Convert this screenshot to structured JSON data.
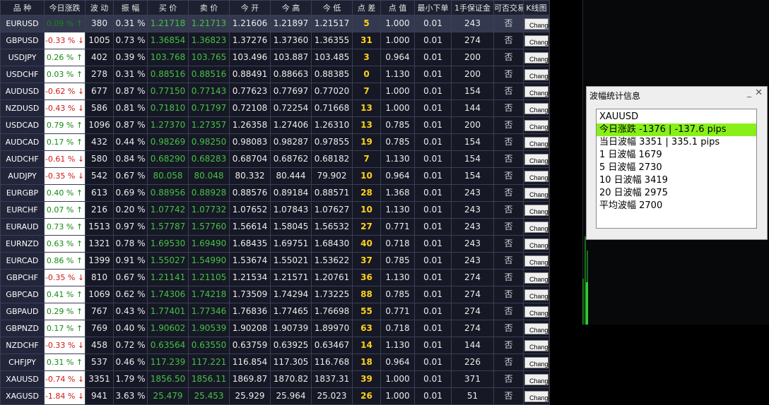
{
  "headers": [
    "品 种",
    "今日涨跌",
    "波 动",
    "振 幅",
    "买 价",
    "卖 价",
    "今 开",
    "今 高",
    "今 低",
    "点 差",
    "点 值",
    "最小下单",
    "1手保证金",
    "可否交易",
    "K线图"
  ],
  "rows": [
    {
      "sym": "EURUSD",
      "chg": "0.09 % ↑",
      "dir": "up",
      "vol": "380",
      "amp": "0.31 %",
      "bid": "1.21718",
      "ask": "1.21713",
      "open": "1.21606",
      "high": "1.21897",
      "low": "1.21517",
      "spread": "5",
      "pv": "1.000",
      "min": "0.01",
      "margin": "243",
      "trade": "否",
      "kline": "Change"
    },
    {
      "sym": "GBPUSD",
      "chg": "-0.33 % ↓",
      "dir": "down",
      "vol": "1005",
      "amp": "0.73 %",
      "bid": "1.36854",
      "ask": "1.36823",
      "open": "1.37276",
      "high": "1.37360",
      "low": "1.36355",
      "spread": "31",
      "pv": "1.000",
      "min": "0.01",
      "margin": "274",
      "trade": "否",
      "kline": "Change"
    },
    {
      "sym": "USDJPY",
      "chg": "0.26 % ↑",
      "dir": "up",
      "vol": "402",
      "amp": "0.39 %",
      "bid": "103.768",
      "ask": "103.765",
      "open": "103.496",
      "high": "103.887",
      "low": "103.485",
      "spread": "3",
      "pv": "0.964",
      "min": "0.01",
      "margin": "200",
      "trade": "否",
      "kline": "Change"
    },
    {
      "sym": "USDCHF",
      "chg": "0.03 % ↑",
      "dir": "up",
      "vol": "278",
      "amp": "0.31 %",
      "bid": "0.88516",
      "ask": "0.88516",
      "open": "0.88491",
      "high": "0.88663",
      "low": "0.88385",
      "spread": "0",
      "pv": "1.130",
      "min": "0.01",
      "margin": "200",
      "trade": "否",
      "kline": "Change"
    },
    {
      "sym": "AUDUSD",
      "chg": "-0.62 % ↓",
      "dir": "down",
      "vol": "677",
      "amp": "0.87 %",
      "bid": "0.77150",
      "ask": "0.77143",
      "open": "0.77623",
      "high": "0.77697",
      "low": "0.77020",
      "spread": "7",
      "pv": "1.000",
      "min": "0.01",
      "margin": "154",
      "trade": "否",
      "kline": "Change"
    },
    {
      "sym": "NZDUSD",
      "chg": "-0.43 % ↓",
      "dir": "down",
      "vol": "586",
      "amp": "0.81 %",
      "bid": "0.71810",
      "ask": "0.71797",
      "open": "0.72108",
      "high": "0.72254",
      "low": "0.71668",
      "spread": "13",
      "pv": "1.000",
      "min": "0.01",
      "margin": "144",
      "trade": "否",
      "kline": "Change"
    },
    {
      "sym": "USDCAD",
      "chg": "0.79 % ↑",
      "dir": "up",
      "vol": "1096",
      "amp": "0.87 %",
      "bid": "1.27370",
      "ask": "1.27357",
      "open": "1.26358",
      "high": "1.27406",
      "low": "1.26310",
      "spread": "13",
      "pv": "0.785",
      "min": "0.01",
      "margin": "200",
      "trade": "否",
      "kline": "Change"
    },
    {
      "sym": "AUDCAD",
      "chg": "0.17 % ↑",
      "dir": "up",
      "vol": "432",
      "amp": "0.44 %",
      "bid": "0.98269",
      "ask": "0.98250",
      "open": "0.98083",
      "high": "0.98287",
      "low": "0.97855",
      "spread": "19",
      "pv": "0.785",
      "min": "0.01",
      "margin": "154",
      "trade": "否",
      "kline": "Change"
    },
    {
      "sym": "AUDCHF",
      "chg": "-0.61 % ↓",
      "dir": "down",
      "vol": "580",
      "amp": "0.84 %",
      "bid": "0.68290",
      "ask": "0.68283",
      "open": "0.68704",
      "high": "0.68762",
      "low": "0.68182",
      "spread": "7",
      "pv": "1.130",
      "min": "0.01",
      "margin": "154",
      "trade": "否",
      "kline": "Change"
    },
    {
      "sym": "AUDJPY",
      "chg": "-0.35 % ↓",
      "dir": "down",
      "vol": "542",
      "amp": "0.67 %",
      "bid": "80.058",
      "ask": "80.048",
      "open": "80.332",
      "high": "80.444",
      "low": "79.902",
      "spread": "10",
      "pv": "0.964",
      "min": "0.01",
      "margin": "154",
      "trade": "否",
      "kline": "Change"
    },
    {
      "sym": "EURGBP",
      "chg": "0.40 % ↑",
      "dir": "up",
      "vol": "613",
      "amp": "0.69 %",
      "bid": "0.88956",
      "ask": "0.88928",
      "open": "0.88576",
      "high": "0.89184",
      "low": "0.88571",
      "spread": "28",
      "pv": "1.368",
      "min": "0.01",
      "margin": "243",
      "trade": "否",
      "kline": "Change"
    },
    {
      "sym": "EURCHF",
      "chg": "0.07 % ↑",
      "dir": "up",
      "vol": "216",
      "amp": "0.20 %",
      "bid": "1.07742",
      "ask": "1.07732",
      "open": "1.07652",
      "high": "1.07843",
      "low": "1.07627",
      "spread": "10",
      "pv": "1.130",
      "min": "0.01",
      "margin": "243",
      "trade": "否",
      "kline": "Change"
    },
    {
      "sym": "EURAUD",
      "chg": "0.73 % ↑",
      "dir": "up",
      "vol": "1513",
      "amp": "0.97 %",
      "bid": "1.57787",
      "ask": "1.57760",
      "open": "1.56614",
      "high": "1.58045",
      "low": "1.56532",
      "spread": "27",
      "pv": "0.771",
      "min": "0.01",
      "margin": "243",
      "trade": "否",
      "kline": "Change"
    },
    {
      "sym": "EURNZD",
      "chg": "0.63 % ↑",
      "dir": "up",
      "vol": "1321",
      "amp": "0.78 %",
      "bid": "1.69530",
      "ask": "1.69490",
      "open": "1.68435",
      "high": "1.69751",
      "low": "1.68430",
      "spread": "40",
      "pv": "0.718",
      "min": "0.01",
      "margin": "243",
      "trade": "否",
      "kline": "Change"
    },
    {
      "sym": "EURCAD",
      "chg": "0.86 % ↑",
      "dir": "up",
      "vol": "1399",
      "amp": "0.91 %",
      "bid": "1.55027",
      "ask": "1.54990",
      "open": "1.53674",
      "high": "1.55021",
      "low": "1.53622",
      "spread": "37",
      "pv": "0.785",
      "min": "0.01",
      "margin": "243",
      "trade": "否",
      "kline": "Change"
    },
    {
      "sym": "GBPCHF",
      "chg": "-0.35 % ↓",
      "dir": "down",
      "vol": "810",
      "amp": "0.67 %",
      "bid": "1.21141",
      "ask": "1.21105",
      "open": "1.21534",
      "high": "1.21571",
      "low": "1.20761",
      "spread": "36",
      "pv": "1.130",
      "min": "0.01",
      "margin": "274",
      "trade": "否",
      "kline": "Change"
    },
    {
      "sym": "GBPCAD",
      "chg": "0.41 % ↑",
      "dir": "up",
      "vol": "1069",
      "amp": "0.62 %",
      "bid": "1.74306",
      "ask": "1.74218",
      "open": "1.73509",
      "high": "1.74294",
      "low": "1.73225",
      "spread": "88",
      "pv": "0.785",
      "min": "0.01",
      "margin": "274",
      "trade": "否",
      "kline": "Change"
    },
    {
      "sym": "GBPAUD",
      "chg": "0.29 % ↑",
      "dir": "up",
      "vol": "767",
      "amp": "0.43 %",
      "bid": "1.77401",
      "ask": "1.77346",
      "open": "1.76836",
      "high": "1.77465",
      "low": "1.76698",
      "spread": "55",
      "pv": "0.771",
      "min": "0.01",
      "margin": "274",
      "trade": "否",
      "kline": "Change"
    },
    {
      "sym": "GBPNZD",
      "chg": "0.17 % ↑",
      "dir": "up",
      "vol": "769",
      "amp": "0.40 %",
      "bid": "1.90602",
      "ask": "1.90539",
      "open": "1.90208",
      "high": "1.90739",
      "low": "1.89970",
      "spread": "63",
      "pv": "0.718",
      "min": "0.01",
      "margin": "274",
      "trade": "否",
      "kline": "Change"
    },
    {
      "sym": "NZDCHF",
      "chg": "-0.33 % ↓",
      "dir": "down",
      "vol": "458",
      "amp": "0.72 %",
      "bid": "0.63564",
      "ask": "0.63550",
      "open": "0.63759",
      "high": "0.63925",
      "low": "0.63467",
      "spread": "14",
      "pv": "1.130",
      "min": "0.01",
      "margin": "144",
      "trade": "否",
      "kline": "Change"
    },
    {
      "sym": "CHFJPY",
      "chg": "0.31 % ↑",
      "dir": "up",
      "vol": "537",
      "amp": "0.46 %",
      "bid": "117.239",
      "ask": "117.221",
      "open": "116.854",
      "high": "117.305",
      "low": "116.768",
      "spread": "18",
      "pv": "0.964",
      "min": "0.01",
      "margin": "226",
      "trade": "否",
      "kline": "Change"
    },
    {
      "sym": "XAUUSD",
      "chg": "-0.74 % ↓",
      "dir": "down",
      "vol": "3351",
      "amp": "1.79 %",
      "bid": "1856.50",
      "ask": "1856.11",
      "open": "1869.87",
      "high": "1870.82",
      "low": "1837.31",
      "spread": "39",
      "pv": "1.000",
      "min": "0.01",
      "margin": "371",
      "trade": "否",
      "kline": "Change"
    },
    {
      "sym": "XAGUSD",
      "chg": "-1.84 % ↓",
      "dir": "down",
      "vol": "941",
      "amp": "3.63 %",
      "bid": "25.479",
      "ask": "25.453",
      "open": "25.929",
      "high": "25.964",
      "low": "25.023",
      "spread": "26",
      "pv": "1.000",
      "min": "0.01",
      "margin": "51",
      "trade": "否",
      "kline": "Change"
    }
  ],
  "panel": {
    "title": "波幅统计信息",
    "min_glyph": "_",
    "close_glyph": "✕",
    "lines": [
      {
        "text": "XAUUSD",
        "highlight": false
      },
      {
        "text": "今日涨跌 -1376 | -137.6 pips",
        "highlight": true
      },
      {
        "text": "当日波幅 3351 | 335.1 pips",
        "highlight": false
      },
      {
        "text": "1 日波幅 1679",
        "highlight": false
      },
      {
        "text": "5 日波幅 2730",
        "highlight": false
      },
      {
        "text": "10 日波幅 3419",
        "highlight": false
      },
      {
        "text": "20 日波幅 2975",
        "highlight": false
      },
      {
        "text": "平均波幅 2700",
        "highlight": false
      }
    ]
  },
  "colors": {
    "up": "#138a13",
    "down": "#d01818",
    "price": "#45c143",
    "spread": "#ffd21a",
    "highlight": "#88f018"
  }
}
